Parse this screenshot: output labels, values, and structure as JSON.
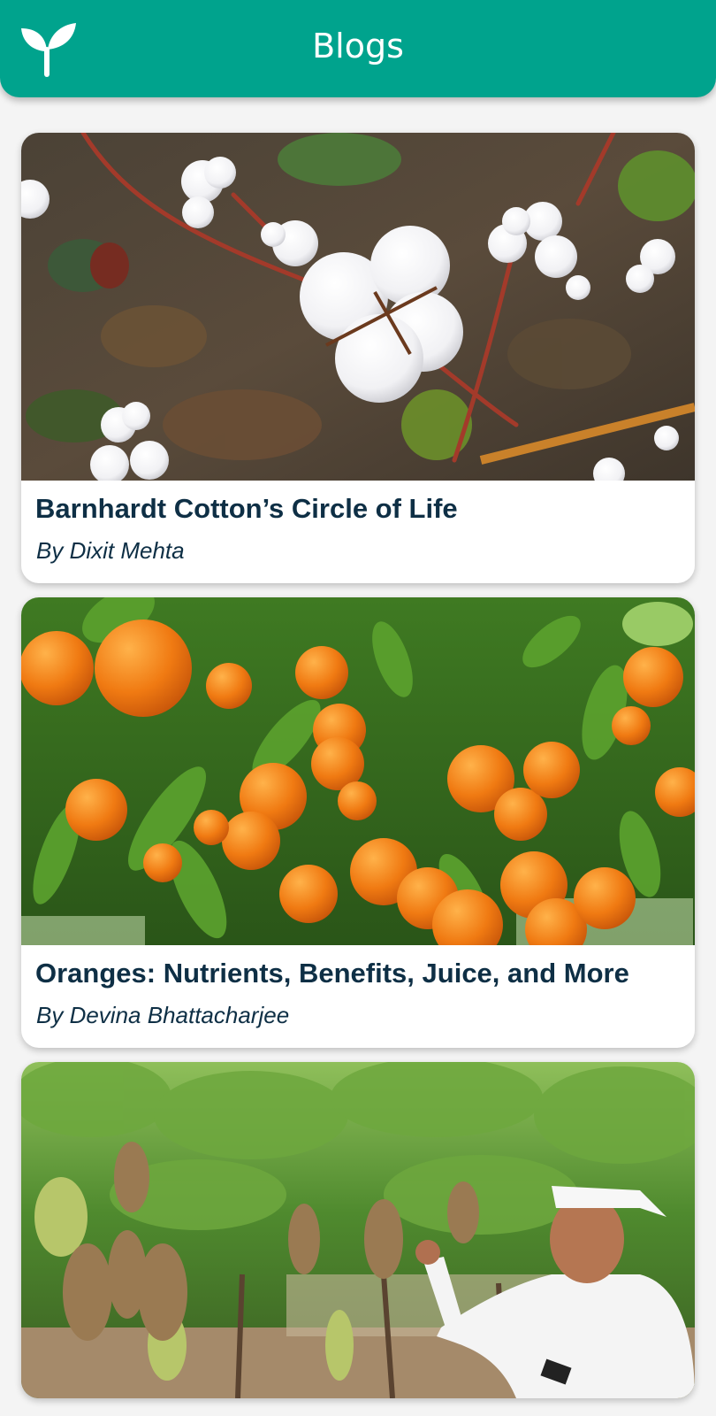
{
  "app_bar": {
    "title": "Blogs",
    "logo_icon": "sprout-icon",
    "background": "#00a38d"
  },
  "blogs": [
    {
      "title": "Barnhardt Cotton’s Circle of Life",
      "author": "By Dixit Mehta",
      "image_subject": "cotton bolls on plant"
    },
    {
      "title": "Oranges: Nutrients, Benefits, Juice, and More",
      "author": "By Devina Bhattacharjee",
      "image_subject": "oranges on tree"
    },
    {
      "title": "",
      "author": "",
      "image_subject": "farmer inspecting grape vines"
    }
  ],
  "colors": {
    "title_text": "#0e2f45",
    "card_bg": "#ffffff",
    "page_bg": "#f4f4f4"
  }
}
